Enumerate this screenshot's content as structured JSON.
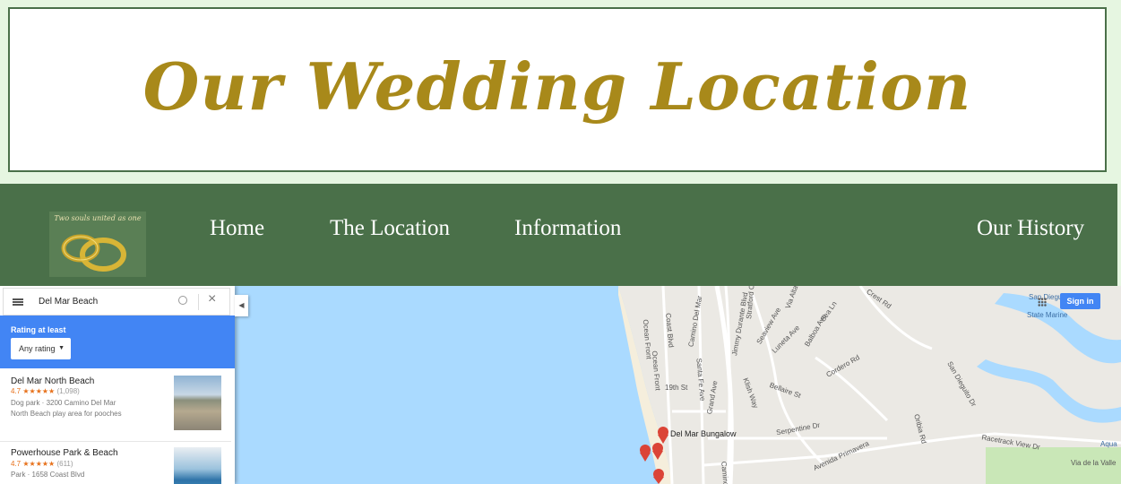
{
  "header": {
    "title": "Our Wedding Location"
  },
  "logo": {
    "caption": "Two souls united as one"
  },
  "nav": {
    "home": "Home",
    "location": "The Location",
    "information": "Information",
    "history": "Our History"
  },
  "map": {
    "search": {
      "query": "Del Mar Beach"
    },
    "filter": {
      "label": "Rating at least",
      "selected": "Any rating"
    },
    "results": [
      {
        "name": "Del Mar North Beach",
        "rating": "4.7",
        "stars": "★★★★★",
        "count": "(1,098)",
        "meta1": "Dog park · 3200 Camino Del Mar",
        "meta2": "North Beach play area for pooches"
      },
      {
        "name": "Powerhouse Park & Beach",
        "rating": "4.7",
        "stars": "★★★★★",
        "count": "(611)",
        "meta1": "Park · 1658 Coast Blvd"
      }
    ],
    "signin": "Sign in",
    "place_label": "Del Mar Bungalow",
    "streets": [
      "Camino Del Mar",
      "Jimmy Durante Blvd",
      "Ocean Front",
      "Coast Blvd",
      "Ocean Front",
      "Stratford Ct",
      "Via Alta",
      "Seaview Ave",
      "Luneta Ave",
      "Balboa Ave",
      "Sea Ln",
      "19th St",
      "Grand Ave",
      "Klish Way",
      "Bellaire St",
      "Serpentine Dr",
      "Avenida Primavera",
      "Crest Rd",
      "Racetrack View Dr",
      "San Dieguito Dr",
      "Camino",
      "Via de la Valle",
      "Oribia Rd",
      "Santa Fe Ave",
      "Cordero Rd"
    ],
    "water": [
      "San Dieguito Lagoon",
      "State Marine",
      "Aqua"
    ]
  }
}
